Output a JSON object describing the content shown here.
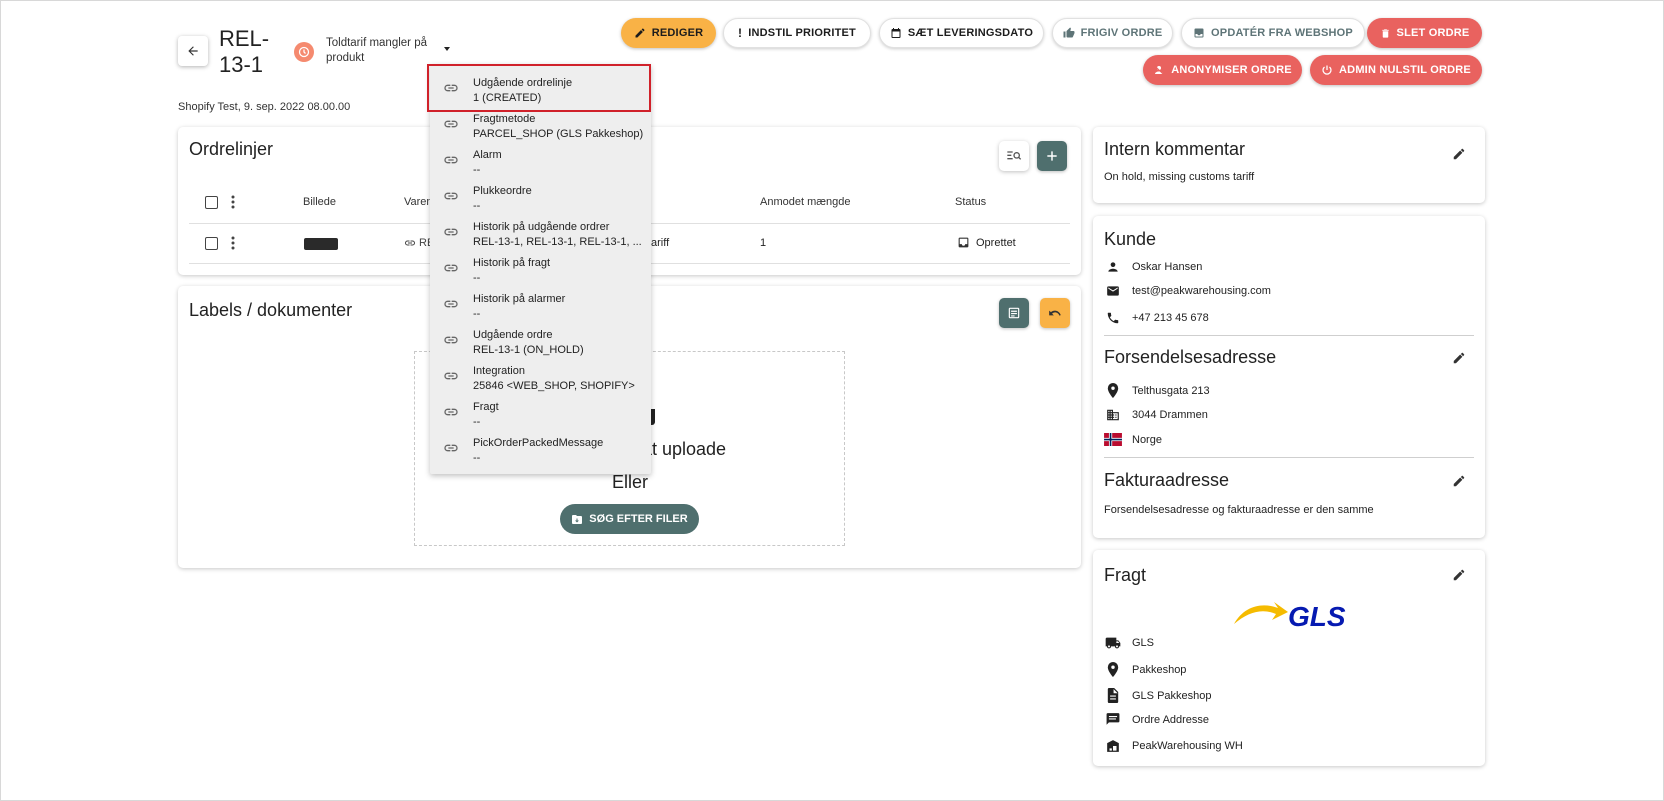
{
  "header": {
    "order_title": "REL-13-1",
    "warning_text": "Toldtarif mangler på produkt",
    "source_line": "Shopify Test, 9. sep. 2022 08.00.00"
  },
  "toolbar": {
    "edit": "REDIGER",
    "priority": "INDSTIL PRIORITET",
    "delivery_date": "SÆT LEVERINGSDATO",
    "release": "FRIGIV ORDRE",
    "update_webshop": "OPDATÉR FRA WEBSHOP",
    "delete": "SLET ORDRE",
    "anonymize": "ANONYMISER ORDRE",
    "admin_reset": "ADMIN NULSTIL ORDRE"
  },
  "orderlines": {
    "title": "Ordrelinjer",
    "columns": {
      "image": "Billede",
      "item": "Varen",
      "requested_qty": "Anmodet mængde",
      "status": "Status"
    },
    "row": {
      "item_prefix": "RE",
      "item_suffix": "ariff",
      "qty": "1",
      "status": "Oprettet"
    }
  },
  "labels": {
    "title": "Labels / dokumenter",
    "upload_text_tail": "r at uploade",
    "or_text": "Eller",
    "search_files": "SØG EFTER FILER"
  },
  "dropdown": {
    "items": [
      {
        "title": "Udgående ordrelinje",
        "value": "1 (CREATED)"
      },
      {
        "title": "Fragtmetode",
        "value": "PARCEL_SHOP (GLS Pakkeshop)"
      },
      {
        "title": "Alarm",
        "value": "--"
      },
      {
        "title": "Plukkeordre",
        "value": "--"
      },
      {
        "title": "Historik på udgående ordrer",
        "value": "REL-13-1, REL-13-1, REL-13-1, ..."
      },
      {
        "title": "Historik på fragt",
        "value": "--"
      },
      {
        "title": "Historik på alarmer",
        "value": "--"
      },
      {
        "title": "Udgående ordre",
        "value": "REL-13-1 (ON_HOLD)"
      },
      {
        "title": "Integration",
        "value": "25846 <WEB_SHOP, SHOPIFY>"
      },
      {
        "title": "Fragt",
        "value": "--"
      },
      {
        "title": "PickOrderPackedMessage",
        "value": "--"
      }
    ]
  },
  "internal_comment": {
    "title": "Intern kommentar",
    "text": "On hold, missing customs tariff"
  },
  "customer": {
    "title": "Kunde",
    "name": "Oskar Hansen",
    "email": "test@peakwarehousing.com",
    "phone": "+47 213 45 678"
  },
  "shipping_address": {
    "title": "Forsendelsesadresse",
    "street": "Telthusgata 213",
    "city": "3044 Drammen",
    "country": "Norge"
  },
  "billing_address": {
    "title": "Fakturaadresse",
    "text": "Forsendelsesadresse og fakturaadresse er den samme"
  },
  "freight": {
    "title": "Fragt",
    "carrier": "GLS",
    "method": "Pakkeshop",
    "product": "GLS Pakkeshop",
    "address": "Ordre Addresse",
    "warehouse": "PeakWarehousing WH"
  },
  "colors": {
    "accent_yellow": "#f9b246",
    "danger_red": "#e9625f",
    "teal": "#4f6f6e",
    "warning_orange": "#f58a6f",
    "highlight_red": "#d0212a",
    "gls_blue": "#061ab1",
    "gls_yellow": "#f5bb00"
  },
  "icons": {
    "back": "arrow-left-icon",
    "warning": "clock-icon",
    "caret": "caret-down-icon",
    "edit": "pencil-icon",
    "priority": "exclamation-icon",
    "calendar": "calendar-icon",
    "release": "thumbs-up-icon",
    "update": "download-box-icon",
    "delete": "trash-icon",
    "anonymize": "person-off-icon",
    "reset": "power-icon",
    "link": "link-icon"
  }
}
